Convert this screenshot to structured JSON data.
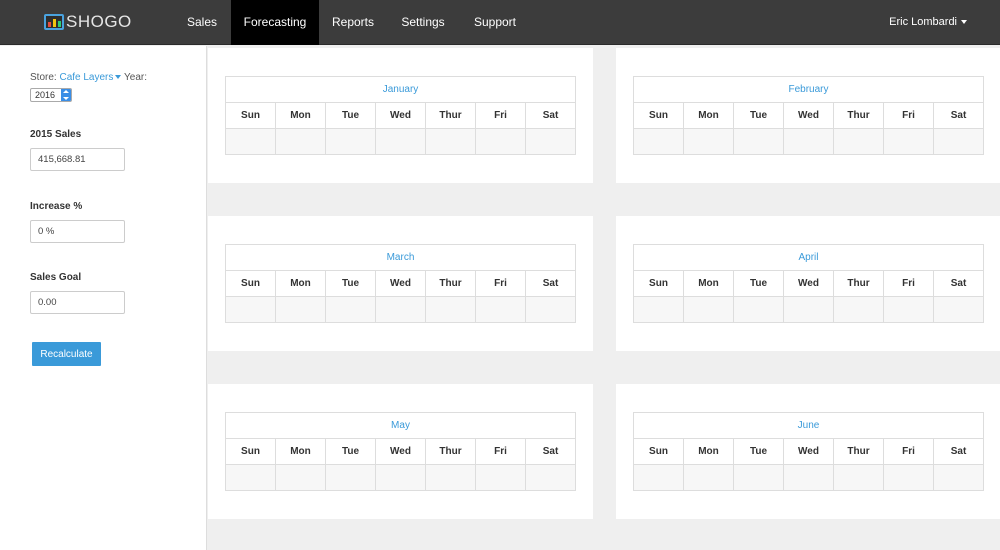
{
  "brand": {
    "name": "SHOGO"
  },
  "nav": {
    "items": [
      "Sales",
      "Forecasting",
      "Reports",
      "Settings",
      "Support"
    ],
    "active": "Forecasting",
    "user": "Eric Lombardi"
  },
  "sidebar": {
    "store_label": "Store:",
    "store_value": "Cafe Layers",
    "year_label": "Year:",
    "year_value": "2016",
    "sales_label": "2015 Sales",
    "sales_value": "415,668.81",
    "increase_label": "Increase %",
    "increase_value": "0 %",
    "goal_label": "Sales Goal",
    "goal_value": "0.00",
    "recalculate_label": "Recalculate"
  },
  "calendar": {
    "months": [
      "January",
      "February",
      "March",
      "April",
      "May",
      "June"
    ],
    "days": [
      "Sun",
      "Mon",
      "Tue",
      "Wed",
      "Thur",
      "Fri",
      "Sat"
    ]
  }
}
